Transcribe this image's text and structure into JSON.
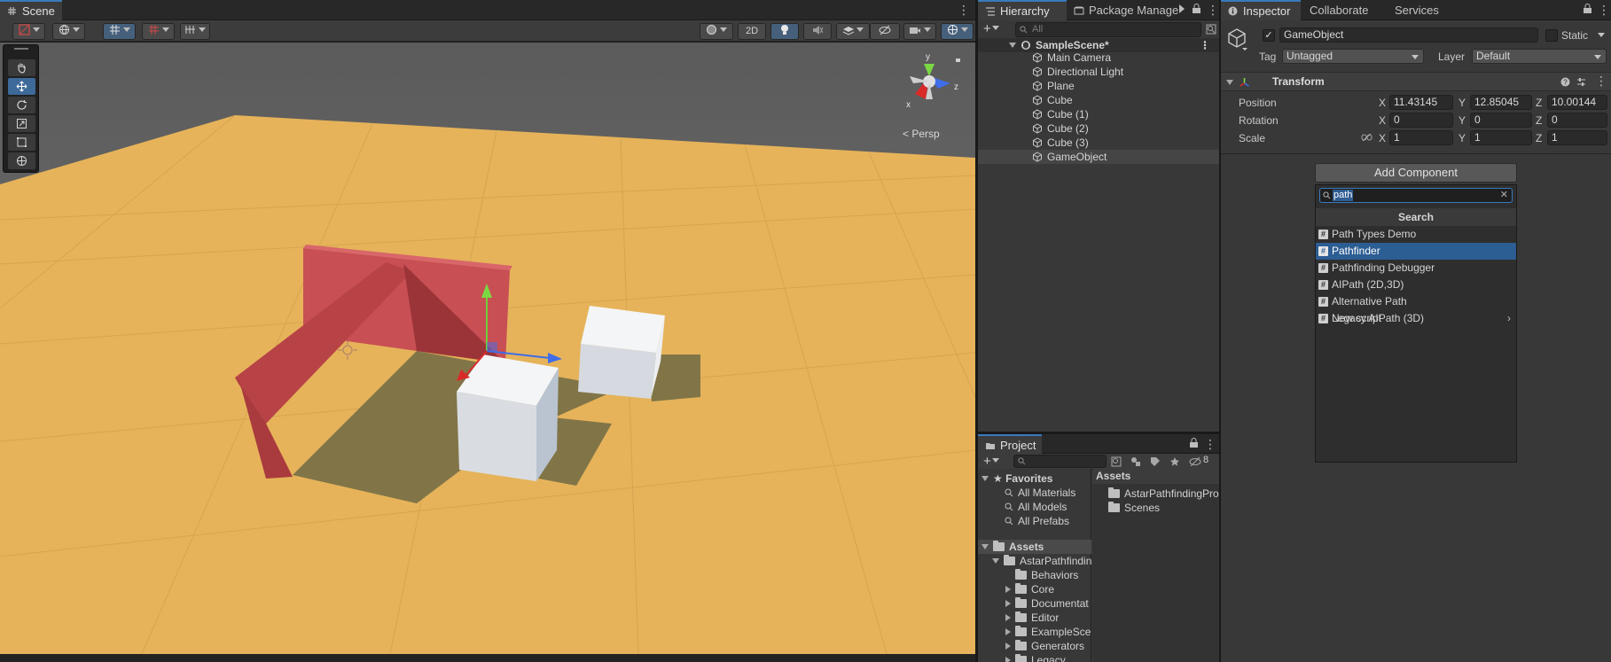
{
  "scene": {
    "tab": "Scene",
    "toolbar": {
      "mode2d": "2D"
    },
    "persp_label": "Persp",
    "gizmo_axes": {
      "y": "y",
      "z": "z",
      "x": "x"
    }
  },
  "hierarchy": {
    "tabs": [
      "Hierarchy",
      "Package Manage"
    ],
    "search_placeholder": "All",
    "scene_name": "SampleScene*",
    "items": [
      "Main Camera",
      "Directional Light",
      "Plane",
      "Cube",
      "Cube (1)",
      "Cube (2)",
      "Cube (3)",
      "GameObject"
    ],
    "selected_item": "GameObject"
  },
  "project": {
    "tab": "Project",
    "hidden_count": "8",
    "favorites_label": "Favorites",
    "favorites": [
      "All Materials",
      "All Models",
      "All Prefabs"
    ],
    "assets_label": "Assets",
    "tree": [
      "AstarPathfindin",
      "Behaviors",
      "Core",
      "Documentat",
      "Editor",
      "ExampleSce",
      "Generators",
      "Legacy"
    ],
    "right_header": "Assets",
    "right_items": [
      "AstarPathfindingPro",
      "Scenes"
    ]
  },
  "inspector": {
    "tabs": [
      "Inspector",
      "Collaborate",
      "Services"
    ],
    "object_name": "GameObject",
    "static_label": "Static",
    "tag_label": "Tag",
    "tag_value": "Untagged",
    "layer_label": "Layer",
    "layer_value": "Default",
    "transform_title": "Transform",
    "position_label": "Position",
    "rotation_label": "Rotation",
    "scale_label": "Scale",
    "axis_labels": {
      "x": "X",
      "y": "Y",
      "z": "Z"
    },
    "position": {
      "x": "11.43145",
      "y": "12.85045",
      "z": "10.00144"
    },
    "rotation": {
      "x": "0",
      "y": "0",
      "z": "0"
    },
    "scale": {
      "x": "1",
      "y": "1",
      "z": "1"
    },
    "add_component_label": "Add Component",
    "search_text": "path",
    "search_header": "Search",
    "results": [
      "Path Types Demo",
      "Pathfinder",
      "Pathfinding Debugger",
      "AIPath (2D,3D)",
      "Alternative Path",
      "Legacy AIPath (3D)"
    ],
    "highlighted_result": "Pathfinder",
    "new_script_label": "New script"
  },
  "colors": {
    "ground": "#e6b35a",
    "wall": "#c84f54",
    "cube": "#e9ecef",
    "selection": "#2c5d93",
    "accent": "#3a79bb"
  }
}
